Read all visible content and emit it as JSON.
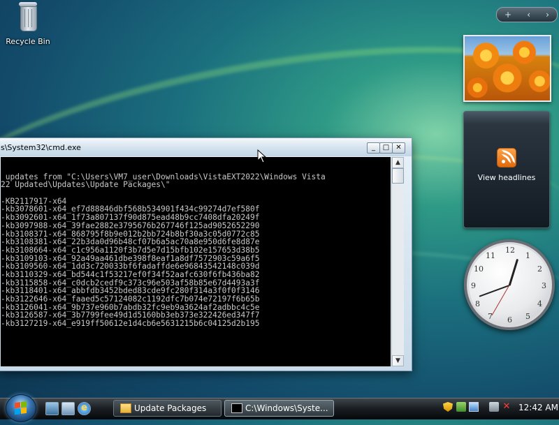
{
  "desktop": {
    "icons": [
      {
        "label": "Recycle Bin",
        "icon": "recycle-bin-icon"
      }
    ]
  },
  "sidebar": {
    "controls": {
      "add": "+",
      "prev": "‹",
      "next": "›"
    },
    "feed_gadget": {
      "label": "View headlines",
      "icon": "rss-icon"
    },
    "clock_gadget": {
      "numbers": [
        "12",
        "1",
        "2",
        "3",
        "4",
        "5",
        "6",
        "7",
        "8",
        "9",
        "10",
        "11"
      ]
    }
  },
  "cmd_window": {
    "title": "s\\System32\\cmd.exe",
    "buttons": {
      "minimize": "_",
      "maximize": "□",
      "close": "✕"
    },
    "lines": [
      "",
      " updates from \"C:\\Users\\VM7_user\\Downloads\\VistaEXT2022\\Windows Vista",
      "22 Updated\\Updates\\Update Packages\\\"",
      "",
      "-KB2117917-x64",
      "-kb3078601-x64_ef7d88846dbf568b534901f434c99274d7ef580f",
      "-kb3092601-x64_1f73a807137f90d875ead48b9cc7408dfa20249f",
      "-kb3097988-x64_39fae2882e3795676b267746f125ad9052652290",
      "-kb3108371-x64_868795f8b9e012b2bb724b8bf30a3c05d0772c85",
      "-kb3108381-x64_22b3da0d96b48cf07b6a5ac70a8e950d6fe8d87e",
      "-kb3108664-x64_c1c956a1120f3b7d5e7d15bfb102e157653d38b5",
      "-kb3109103-x64_92a49aa461dbe398f8eaf1a8df7572903c59a6f5",
      "-kb3109560-x64_1dd3c720033bf6fadaffde6e96843542148c039d",
      "-kb3110329-x64_bd544c1f53217ef0f34f52aafc630f6fb436ba82",
      "-kb3115858-x64_c0dcb2cedf9c373c96e503af58b85e67d4493a3f",
      "-kb3118401-x64_abbfdb3452bded83cde9fc280f314a3f0f0f3146",
      "-kb3122646-x64_faaed5c57124082c1192dfc7b074e72197f6b65b",
      "-kb3126041-x64_9b737e960b7abdb32fc9eb9a3624af2adbbc4c5e",
      "-kb3126587-x64_3b7799fee49d1d5160bb3eb373e322426ed347f7",
      "-kb3127219-x64_e919ff50612e1d4cb6e5631215b6c04125d2b195"
    ]
  },
  "taskbar": {
    "start_label": "Start",
    "quick_launch": [
      "show-desktop-icon",
      "switch-windows-icon",
      "internet-explorer-icon"
    ],
    "tasks": [
      {
        "label": "Update Packages",
        "icon": "folder-icon",
        "active": false
      },
      {
        "label": "C:\\Windows\\Syste...",
        "icon": "cmd-icon",
        "active": true
      }
    ],
    "tray": [
      "security-shield-icon",
      "network-icon",
      "display-icon",
      "network-disconnected-icon",
      "volume-muted-icon"
    ],
    "time": "12:42 AM"
  },
  "colors": {
    "console_bg": "#000000",
    "console_fg": "#c8c8c8",
    "accent": "#2f9a86"
  }
}
